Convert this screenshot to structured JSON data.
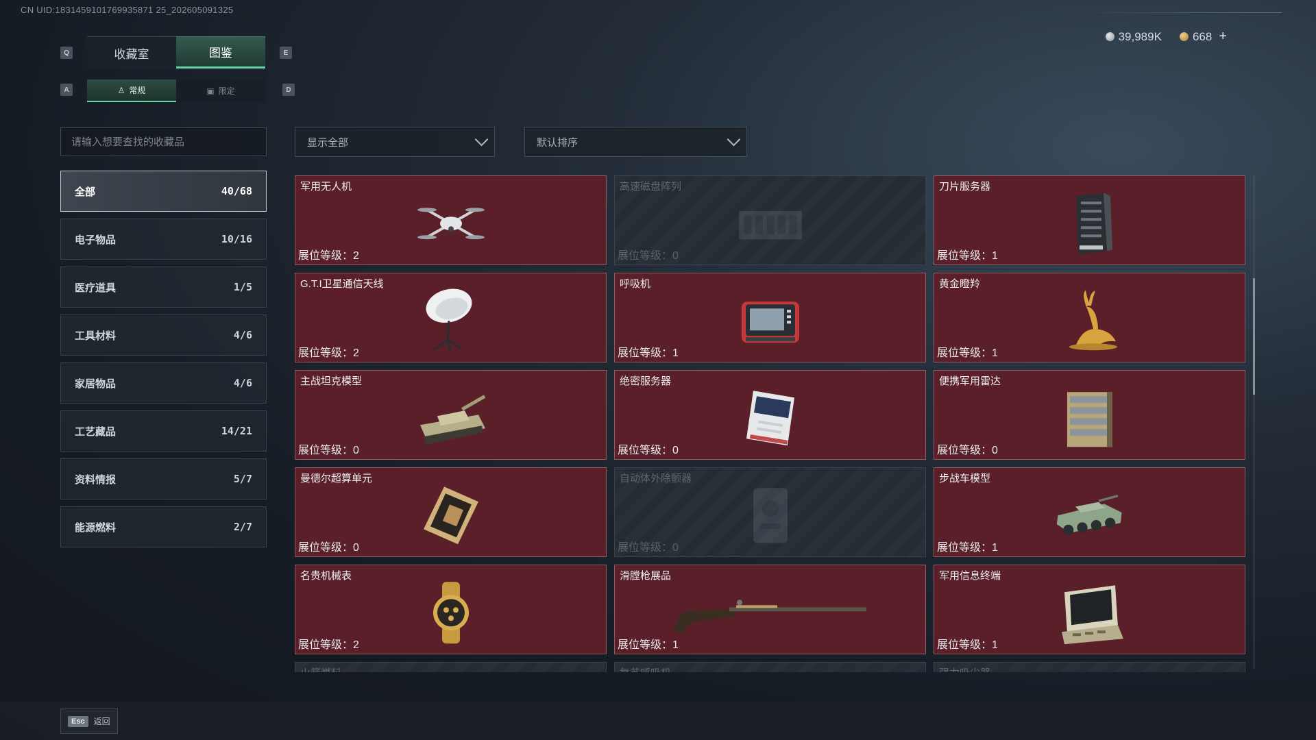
{
  "uid": "CN UID:1831459101769935871 25_202605091325",
  "key_hints": {
    "q": "Q",
    "e": "E",
    "a": "A",
    "d": "D"
  },
  "main_tabs": [
    {
      "label": "收藏室",
      "active": false
    },
    {
      "label": "图鉴",
      "active": true
    }
  ],
  "sub_tabs": [
    {
      "label": "常规",
      "icon": "figure-icon",
      "active": true
    },
    {
      "label": "限定",
      "icon": "card-icon",
      "active": false
    }
  ],
  "currency": {
    "silver": {
      "value": "39,989K",
      "color": "#b8bcc0"
    },
    "gold": {
      "value": "668",
      "color": "#c8a25a"
    },
    "add_label": "+"
  },
  "search": {
    "placeholder": "请输入想要查找的收藏品"
  },
  "filter": {
    "value": "显示全部"
  },
  "sort": {
    "value": "默认排序"
  },
  "categories": [
    {
      "label": "全部",
      "count": "40/68",
      "active": true
    },
    {
      "label": "电子物品",
      "count": "10/16"
    },
    {
      "label": "医疗道具",
      "count": "1/5"
    },
    {
      "label": "工具材料",
      "count": "4/6"
    },
    {
      "label": "家居物品",
      "count": "4/6"
    },
    {
      "label": "工艺藏品",
      "count": "14/21"
    },
    {
      "label": "资料情报",
      "count": "5/7"
    },
    {
      "label": "能源燃料",
      "count": "2/7"
    }
  ],
  "level_prefix": "展位等级：",
  "items": [
    {
      "name": "军用无人机",
      "level": "2",
      "owned": true,
      "icon": "drone-icon"
    },
    {
      "name": "高速磁盘阵列",
      "level": "0",
      "owned": false,
      "icon": "disk-array-icon"
    },
    {
      "name": "刀片服务器",
      "level": "1",
      "owned": true,
      "icon": "server-icon"
    },
    {
      "name": "G.T.I卫星通信天线",
      "level": "2",
      "owned": true,
      "icon": "satellite-dish-icon"
    },
    {
      "name": "呼吸机",
      "level": "1",
      "owned": true,
      "icon": "ventilator-icon"
    },
    {
      "name": "黄金瞪羚",
      "level": "1",
      "owned": true,
      "icon": "gold-gazelle-icon"
    },
    {
      "name": "主战坦克模型",
      "level": "0",
      "owned": true,
      "icon": "tank-icon"
    },
    {
      "name": "绝密服务器",
      "level": "0",
      "owned": true,
      "icon": "secret-server-icon"
    },
    {
      "name": "便携军用雷达",
      "level": "0",
      "owned": true,
      "icon": "radar-icon"
    },
    {
      "name": "曼德尔超算单元",
      "level": "0",
      "owned": true,
      "icon": "cpu-icon"
    },
    {
      "name": "自动体外除颤器",
      "level": "0",
      "owned": false,
      "icon": "defibrillator-icon"
    },
    {
      "name": "步战车模型",
      "level": "1",
      "owned": true,
      "icon": "apc-icon"
    },
    {
      "name": "名贵机械表",
      "level": "2",
      "owned": true,
      "icon": "watch-icon"
    },
    {
      "name": "滑膛枪展品",
      "level": "1",
      "owned": true,
      "icon": "musket-icon"
    },
    {
      "name": "军用信息终端",
      "level": "1",
      "owned": true,
      "icon": "terminal-icon"
    },
    {
      "name": "火箭燃料",
      "level": "",
      "owned": false,
      "icon": "",
      "partial": true
    },
    {
      "name": "复苏呼吸机",
      "level": "",
      "owned": false,
      "icon": "",
      "partial": true
    },
    {
      "name": "强力吸尘器",
      "level": "",
      "owned": false,
      "icon": "",
      "partial": true
    }
  ],
  "footer": {
    "esc_key": "Esc",
    "back_label": "返回"
  }
}
